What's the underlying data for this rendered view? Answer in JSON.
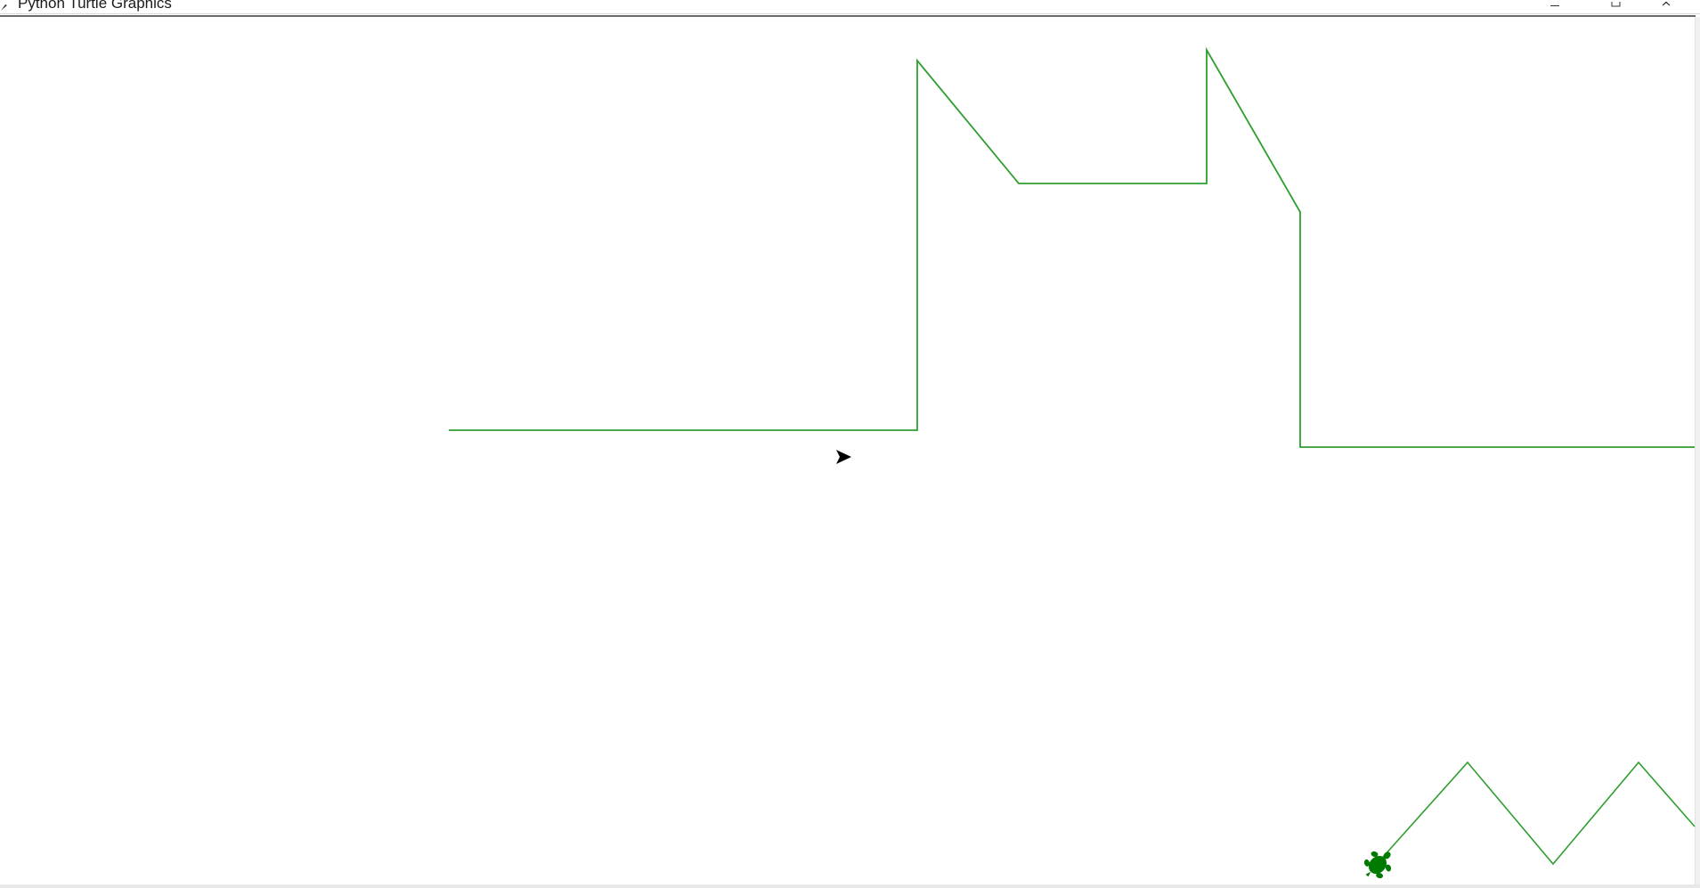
{
  "window": {
    "title": "Python Turtle Graphics",
    "controls": {
      "minimize_icon": "minimize-icon",
      "maximize_icon": "maximize-icon",
      "close_icon": "close-icon"
    }
  },
  "canvas": {
    "background": "#ffffff",
    "pen_color": "#2e9e2e",
    "turtle_color": "#007a00",
    "cursor_color": "#000000"
  },
  "turtles": [
    {
      "shape": "turtle",
      "color": "#007a00"
    },
    {
      "shape": "classic-arrow",
      "color": "#000000"
    }
  ]
}
